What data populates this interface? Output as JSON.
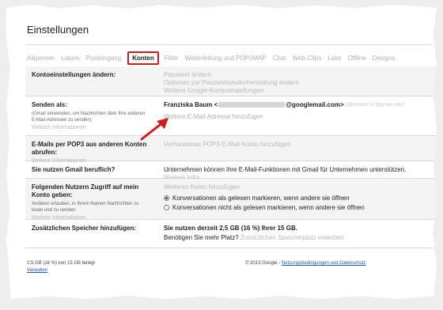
{
  "page": {
    "title": "Einstellungen"
  },
  "tabs": [
    {
      "label": "Allgemein"
    },
    {
      "label": "Labels"
    },
    {
      "label": "Posteingang"
    },
    {
      "label": "Konten",
      "active": true
    },
    {
      "label": "Filter"
    },
    {
      "label": "Weiterleitung und POP/IMAP"
    },
    {
      "label": "Chat"
    },
    {
      "label": "Web-Clips"
    },
    {
      "label": "Labs"
    },
    {
      "label": "Offline"
    },
    {
      "label": "Designs"
    }
  ],
  "rows": {
    "account_settings": {
      "label": "Kontoeinstellungen ändern:",
      "links": [
        "Passwort ändern",
        "Optionen zur Passwortwiederherstellung ändern",
        "Weitere Google-Kontoeinstellungen"
      ]
    },
    "send_as": {
      "label": "Senden als:",
      "note": "(Gmail verwenden, um Nachrichten über Ihre anderen E-Mail-Adressen zu senden)",
      "more_info": "Weitere Informationen",
      "name": "Franziska Baum <",
      "email_domain": "@googlemail.com>",
      "email_hint": "Wechseln zu @gmail.com?",
      "add_address": "Weitere E-Mail-Adresse hinzufügen"
    },
    "pop3": {
      "label": "E-Mails per POP3 aus anderen Konten abrufen:",
      "more_info": "Weitere Informationen",
      "action": "Vorhandenes POP3-E-Mail-Konto hinzufügen"
    },
    "business": {
      "label": "Sie nutzen Gmail beruflich?",
      "text": "Unternehmen können ihre E-Mail-Funktionen mit Gmail für Unternehmen unterstützen.",
      "more_info": "Weitere Infor"
    },
    "grant_access": {
      "label": "Folgenden Nutzern Zugriff auf mein Konto geben:",
      "note": "Anderen erlauben, in Ihrem Namen Nachrichten zu lesen und zu senden",
      "more_info": "Weitere Informationen",
      "action": "Weiteres Konto hinzufügen",
      "option_read": "Konversationen als gelesen markieren, wenn andere sie öffnen",
      "option_unread": "Konversationen nicht als gelesen markieren, wenn andere sie öffnen"
    },
    "storage": {
      "label": "Zusätzlichen Speicher hinzufügen:",
      "usage_text": "Sie nutzen derzeit 2,5 GB (16 %) Ihrer 15 GB.",
      "need_more": "Benötigen Sie mehr Platz?",
      "buy_link": "Zusätzlichen Speicherplatz erwerben"
    }
  },
  "footer": {
    "storage_usage": "2,5 GB (16 %) von 15 GB belegt",
    "manage_link": "Verwalten",
    "copyright": "© 2013 Google - ",
    "terms_link": "Nutzungsbedingungen und Datenschutz"
  },
  "colors": {
    "highlight_red": "#d11a1a",
    "link_blue": "#1a57c4",
    "muted_gray": "#b8b8b8"
  }
}
